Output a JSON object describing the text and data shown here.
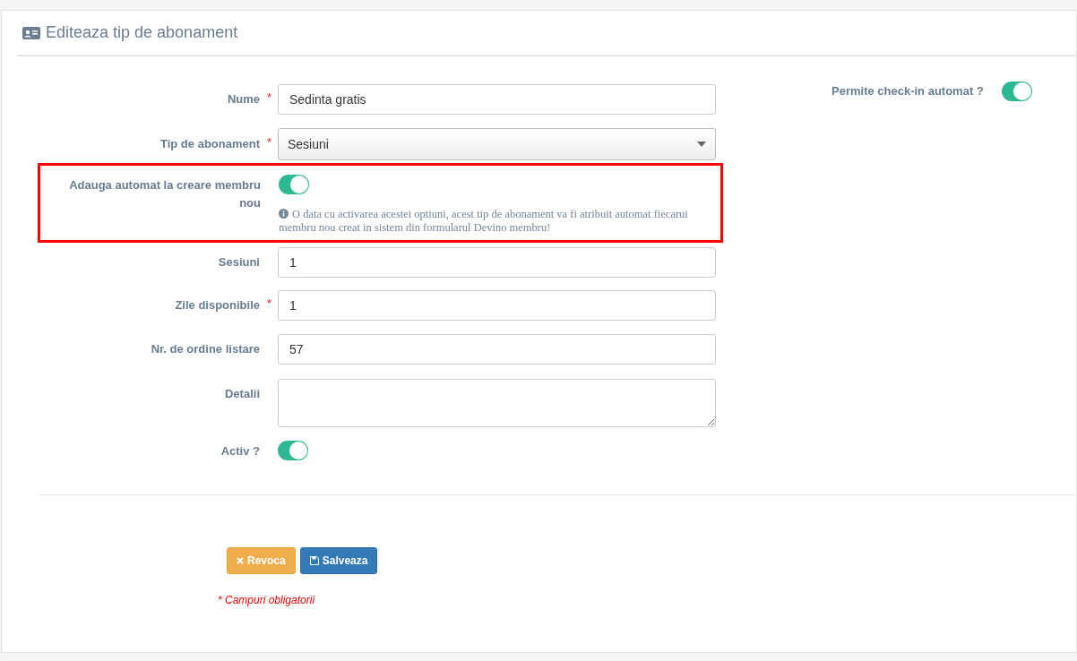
{
  "panel": {
    "title": "Editeaza tip de abonament"
  },
  "fields": [
    {
      "kind": "text",
      "label": "Nume",
      "required_mark": "*",
      "value": "Sedinta gratis"
    },
    {
      "kind": "select",
      "label": "Tip de abonament",
      "required_mark": "*",
      "value": "Sesiuni"
    },
    {
      "kind": "toggle",
      "label": "Adauga automat la creare membru nou",
      "on": true,
      "highlighted": true,
      "help": "O data cu activarea acestei optiuni, acest tip de abonament va fi atribuit automat fiecarui membru nou creat in sistem din formularul Devino membru!"
    },
    {
      "kind": "text",
      "label": "Sesiuni",
      "value": "1"
    },
    {
      "kind": "text",
      "label": "Zile disponibile",
      "required_mark": "*",
      "value": "1"
    },
    {
      "kind": "text",
      "label": "Nr. de ordine listare",
      "value": "57"
    },
    {
      "kind": "textarea",
      "label": "Detalii"
    },
    {
      "kind": "toggle",
      "label": "Activ ?",
      "on": true,
      "highlighted": false
    }
  ],
  "side_fields": [
    {
      "kind": "toggle",
      "label": "Permite check-in automat ?",
      "on": true
    }
  ],
  "buttons": [
    {
      "kind": "cancel",
      "label": "Revoca"
    },
    {
      "kind": "save",
      "label": "Salveaza"
    }
  ],
  "required_note": "* Campuri obligatorii"
}
